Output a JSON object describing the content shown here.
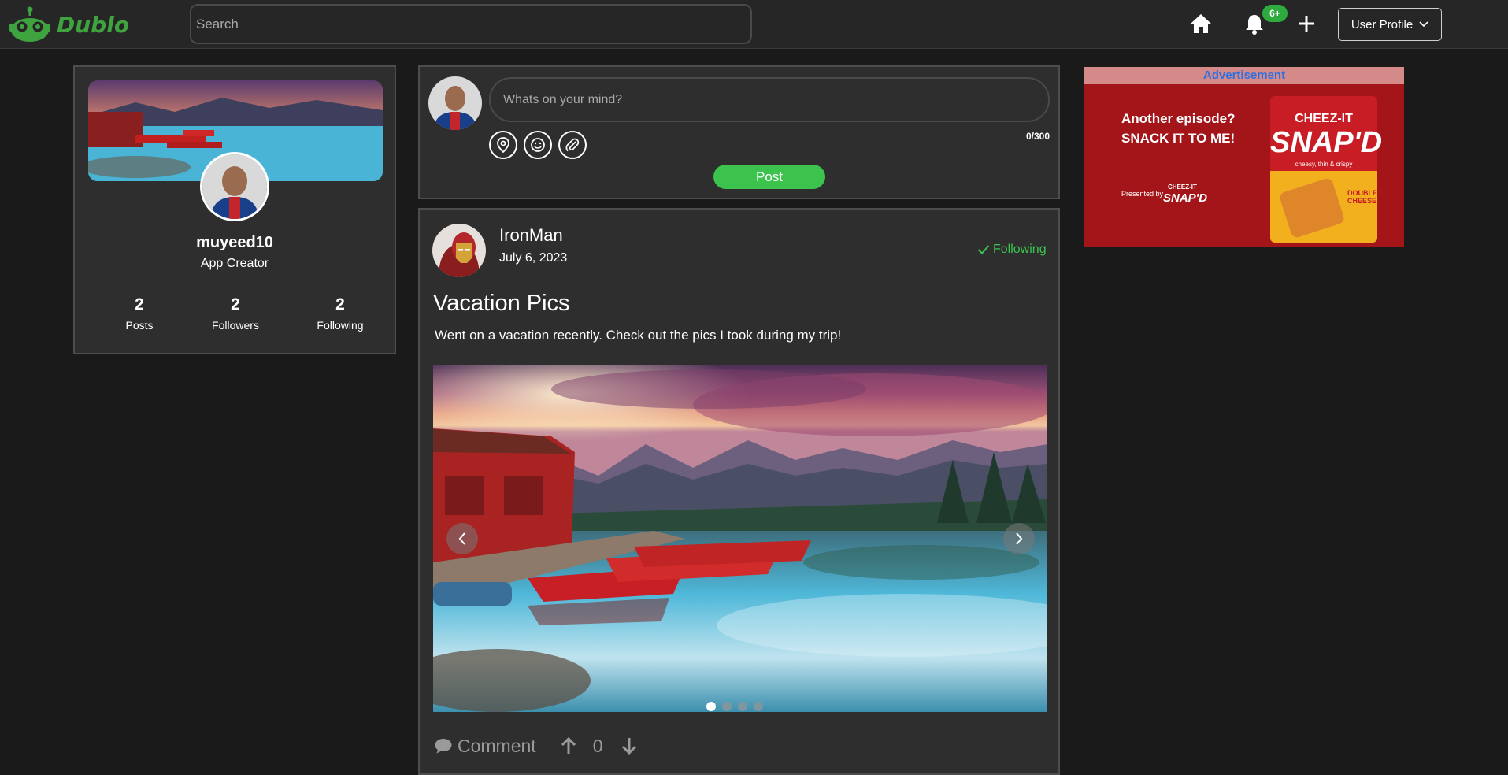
{
  "app": {
    "name": "Dublo"
  },
  "search": {
    "placeholder": "Search"
  },
  "nav": {
    "notification_count": "6+",
    "profile_label": "User Profile"
  },
  "profile": {
    "username": "muyeed10",
    "role": "App Creator",
    "stats": [
      {
        "value": "2",
        "label": "Posts"
      },
      {
        "value": "2",
        "label": "Followers"
      },
      {
        "value": "2",
        "label": "Following"
      }
    ]
  },
  "composer": {
    "placeholder": "Whats on your mind?",
    "counter": "0/300",
    "post_label": "Post"
  },
  "post": {
    "author": "IronMan",
    "date": "July 6, 2023",
    "follow_status": "Following",
    "title": "Vacation Pics",
    "body": "Went on a vacation recently. Check out the pics I took during my trip!",
    "carousel": {
      "slides": 4,
      "active": 0
    },
    "actions": {
      "comment_label": "Comment",
      "votes": "0"
    }
  },
  "ad": {
    "header": "Advertisement",
    "line1": "Another episode?",
    "line2": "SNACK IT TO ME!",
    "presented_by": "Presented by",
    "brand_small": "CHEEZ-IT",
    "brand_small2": "SNAP'D",
    "bag_brand": "CHEEZ-IT",
    "bag_product": "SNAP'D",
    "bag_flavor": "DOUBLE CHEESE",
    "bag_sub": "cheesy, thin & crispy"
  }
}
